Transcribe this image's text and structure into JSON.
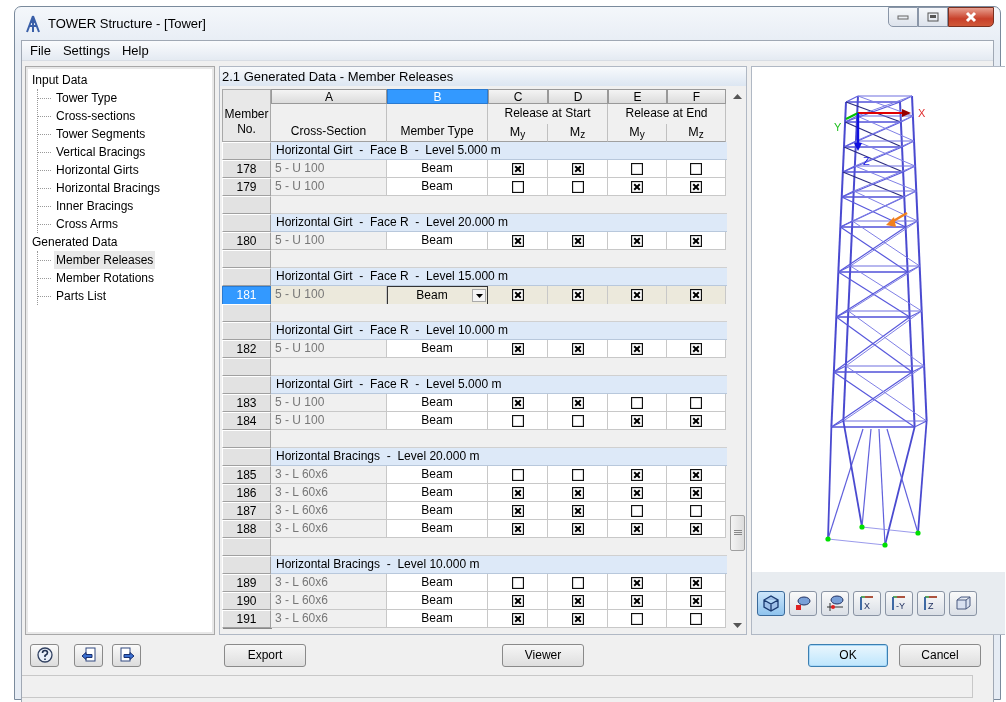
{
  "window": {
    "title": "TOWER Structure - [Tower]"
  },
  "menu": [
    "File",
    "Settings",
    "Help"
  ],
  "tree": [
    {
      "label": "Input Data",
      "children": [
        {
          "label": "Tower Type",
          "selected": false
        },
        {
          "label": "Cross-sections",
          "selected": false
        },
        {
          "label": "Tower Segments",
          "selected": false
        },
        {
          "label": "Vertical Bracings",
          "selected": false
        },
        {
          "label": "Horizontal Girts",
          "selected": false
        },
        {
          "label": "Horizontal Bracings",
          "selected": false
        },
        {
          "label": "Inner Bracings",
          "selected": false
        },
        {
          "label": "Cross Arms",
          "selected": false
        }
      ]
    },
    {
      "label": "Generated Data",
      "children": [
        {
          "label": "Member Releases",
          "selected": true
        },
        {
          "label": "Member Rotations",
          "selected": false
        },
        {
          "label": "Parts List",
          "selected": false
        }
      ]
    }
  ],
  "table": {
    "title": "2.1 Generated Data - Member Releases",
    "column_letters": [
      {
        "label": "A",
        "selected": false
      },
      {
        "label": "B",
        "selected": true
      },
      {
        "label": "C",
        "selected": false
      },
      {
        "label": "D",
        "selected": false
      },
      {
        "label": "E",
        "selected": false
      },
      {
        "label": "F",
        "selected": false
      }
    ],
    "row_header_title": "Member No.",
    "headings": {
      "cross_section": "Cross-Section",
      "member_type": "Member Type",
      "release_start": "Release at Start",
      "release_end": "Release at End",
      "moments": [
        "M$_{y}$",
        "M$_{z}$",
        "M$_{y}$",
        "M$_{z}$"
      ]
    },
    "rows": [
      {
        "kind": "group",
        "label": "Horizontal Girt  -  Face B  -  Level 5.000 m"
      },
      {
        "kind": "member",
        "number": "178",
        "cross_section": "5 - U 100",
        "member_type": "Beam",
        "releases": [
          true,
          true,
          false,
          false
        ],
        "selected": false
      },
      {
        "kind": "member",
        "number": "179",
        "cross_section": "5 - U 100",
        "member_type": "Beam",
        "releases": [
          false,
          false,
          true,
          true
        ],
        "selected": false
      },
      {
        "kind": "blank"
      },
      {
        "kind": "group",
        "label": "Horizontal Girt  -  Face R  -  Level 20.000 m"
      },
      {
        "kind": "member",
        "number": "180",
        "cross_section": "5 - U 100",
        "member_type": "Beam",
        "releases": [
          true,
          true,
          true,
          true
        ],
        "selected": false
      },
      {
        "kind": "blank"
      },
      {
        "kind": "group",
        "label": "Horizontal Girt  -  Face R  -  Level 15.000 m"
      },
      {
        "kind": "member",
        "number": "181",
        "cross_section": "5 - U 100",
        "member_type": "Beam",
        "releases": [
          true,
          true,
          true,
          true
        ],
        "selected": true
      },
      {
        "kind": "blank"
      },
      {
        "kind": "group",
        "label": "Horizontal Girt  -  Face R  -  Level 10.000 m"
      },
      {
        "kind": "member",
        "number": "182",
        "cross_section": "5 - U 100",
        "member_type": "Beam",
        "releases": [
          true,
          true,
          true,
          true
        ],
        "selected": false
      },
      {
        "kind": "blank"
      },
      {
        "kind": "group",
        "label": "Horizontal Girt  -  Face R  -  Level 5.000 m"
      },
      {
        "kind": "member",
        "number": "183",
        "cross_section": "5 - U 100",
        "member_type": "Beam",
        "releases": [
          true,
          true,
          false,
          false
        ],
        "selected": false
      },
      {
        "kind": "member",
        "number": "184",
        "cross_section": "5 - U 100",
        "member_type": "Beam",
        "releases": [
          false,
          false,
          true,
          true
        ],
        "selected": false
      },
      {
        "kind": "blank"
      },
      {
        "kind": "group",
        "label": "Horizontal Bracings  -  Level 20.000 m"
      },
      {
        "kind": "member",
        "number": "185",
        "cross_section": "3 - L 60x6",
        "member_type": "Beam",
        "releases": [
          false,
          false,
          true,
          true
        ],
        "selected": false
      },
      {
        "kind": "member",
        "number": "186",
        "cross_section": "3 - L 60x6",
        "member_type": "Beam",
        "releases": [
          true,
          true,
          true,
          true
        ],
        "selected": false
      },
      {
        "kind": "member",
        "number": "187",
        "cross_section": "3 - L 60x6",
        "member_type": "Beam",
        "releases": [
          true,
          true,
          false,
          false
        ],
        "selected": false
      },
      {
        "kind": "member",
        "number": "188",
        "cross_section": "3 - L 60x6",
        "member_type": "Beam",
        "releases": [
          true,
          true,
          true,
          true
        ],
        "selected": false
      },
      {
        "kind": "blank"
      },
      {
        "kind": "group",
        "label": "Horizontal Bracings  -  Level 10.000 m"
      },
      {
        "kind": "member",
        "number": "189",
        "cross_section": "3 - L 60x6",
        "member_type": "Beam",
        "releases": [
          false,
          false,
          true,
          true
        ],
        "selected": false
      },
      {
        "kind": "member",
        "number": "190",
        "cross_section": "3 - L 60x6",
        "member_type": "Beam",
        "releases": [
          true,
          true,
          true,
          true
        ],
        "selected": false
      },
      {
        "kind": "member",
        "number": "191",
        "cross_section": "3 - L 60x6",
        "member_type": "Beam",
        "releases": [
          true,
          true,
          false,
          false
        ],
        "selected": false
      }
    ]
  },
  "view": {
    "axis_labels": [
      "X",
      "Y",
      "Z"
    ],
    "buttons": [
      {
        "kind": "iso",
        "selected": true
      },
      {
        "kind": "eye",
        "selected": false
      },
      {
        "kind": "eye-pin",
        "selected": false
      },
      {
        "kind": "axis",
        "label": "X",
        "selected": false
      },
      {
        "kind": "axis",
        "label": "-Y",
        "selected": false
      },
      {
        "kind": "axis",
        "label": "Z",
        "selected": false
      },
      {
        "kind": "cube",
        "selected": false
      }
    ]
  },
  "footer": {
    "icon_buttons": [
      {
        "kind": "help"
      },
      {
        "kind": "back"
      },
      {
        "kind": "forward"
      }
    ],
    "buttons": [
      {
        "label": "Export",
        "default": false
      },
      {
        "label": "Viewer",
        "default": false
      },
      {
        "label": "OK",
        "default": true
      },
      {
        "label": "Cancel",
        "default": false
      }
    ]
  }
}
